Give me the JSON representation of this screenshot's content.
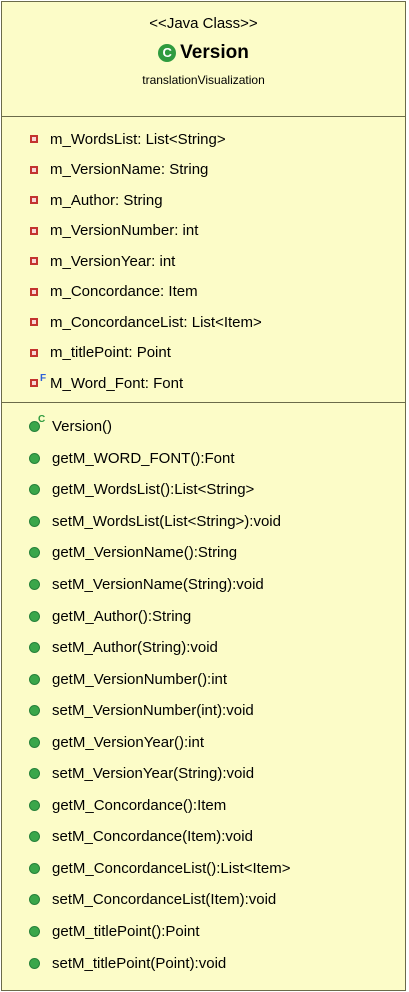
{
  "class": {
    "stereotype": "<<Java Class>>",
    "icon": "class-icon",
    "icon_letter": "C",
    "name": "Version",
    "package": "translationVisualization",
    "colors": {
      "background": "#fcfcc8",
      "border": "#6b6b4a",
      "private": "#c3332f",
      "public": "#3aa64a",
      "final": "#2b5fd8"
    }
  },
  "attributes": [
    {
      "label": "m_WordsList: List<String>",
      "visibility": "private"
    },
    {
      "label": "m_VersionName: String",
      "visibility": "private"
    },
    {
      "label": "m_Author: String",
      "visibility": "private"
    },
    {
      "label": "m_VersionNumber: int",
      "visibility": "private"
    },
    {
      "label": "m_VersionYear: int",
      "visibility": "private"
    },
    {
      "label": "m_Concordance: Item",
      "visibility": "private"
    },
    {
      "label": "m_ConcordanceList: List<Item>",
      "visibility": "private"
    },
    {
      "label": "m_titlePoint: Point",
      "visibility": "private"
    },
    {
      "label": "M_Word_Font: Font",
      "visibility": "private",
      "modifier": "F"
    }
  ],
  "methods": [
    {
      "label": "Version()",
      "visibility": "public",
      "modifier": "C"
    },
    {
      "label": "getM_WORD_FONT():Font",
      "visibility": "public"
    },
    {
      "label": "getM_WordsList():List<String>",
      "visibility": "public"
    },
    {
      "label": "setM_WordsList(List<String>):void",
      "visibility": "public"
    },
    {
      "label": "getM_VersionName():String",
      "visibility": "public"
    },
    {
      "label": "setM_VersionName(String):void",
      "visibility": "public"
    },
    {
      "label": "getM_Author():String",
      "visibility": "public"
    },
    {
      "label": "setM_Author(String):void",
      "visibility": "public"
    },
    {
      "label": "getM_VersionNumber():int",
      "visibility": "public"
    },
    {
      "label": "setM_VersionNumber(int):void",
      "visibility": "public"
    },
    {
      "label": "getM_VersionYear():int",
      "visibility": "public"
    },
    {
      "label": "setM_VersionYear(String):void",
      "visibility": "public"
    },
    {
      "label": "getM_Concordance():Item",
      "visibility": "public"
    },
    {
      "label": "setM_Concordance(Item):void",
      "visibility": "public"
    },
    {
      "label": "getM_ConcordanceList():List<Item>",
      "visibility": "public"
    },
    {
      "label": "setM_ConcordanceList(Item):void",
      "visibility": "public"
    },
    {
      "label": "getM_titlePoint():Point",
      "visibility": "public"
    },
    {
      "label": "setM_titlePoint(Point):void",
      "visibility": "public"
    }
  ]
}
